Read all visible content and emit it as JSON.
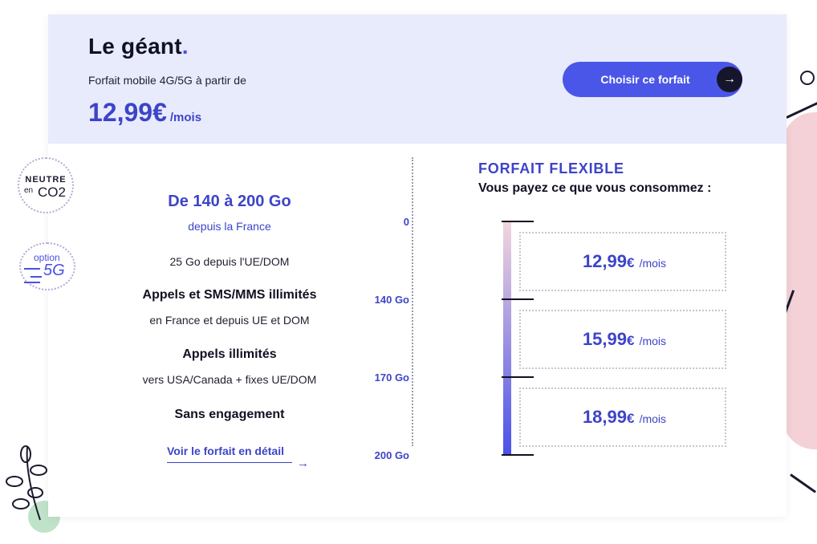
{
  "header": {
    "title": "Le géant",
    "title_dot": ".",
    "subtitle": "Forfait mobile 4G/5G à partir de",
    "price": "12,99€",
    "price_unit": "/mois",
    "cta_label": "Choisir ce forfait"
  },
  "badges": {
    "neutral_line1": "NEUTRE",
    "neutral_en": "en",
    "neutral_co2": "CO2",
    "option_label": "option",
    "option_5g": "5G"
  },
  "features": {
    "data": "De 140 à 200 Go",
    "data_sub": "depuis la France",
    "eu_data": "25 Go depuis l'UE/DOM",
    "calls_sms": "Appels et SMS/MMS illimités",
    "calls_sms_sub": "en France et depuis UE et DOM",
    "calls_intl": "Appels illimités",
    "calls_intl_sub": "vers USA/Canada + fixes UE/DOM",
    "commitment": "Sans engagement",
    "detail_link": "Voir le forfait en détail"
  },
  "flexible": {
    "title": "FORFAIT FLEXIBLE",
    "subtitle": "Vous payez ce que vous consommez :",
    "scale": [
      "0",
      "140 Go",
      "170 Go",
      "200 Go"
    ],
    "tiers": [
      {
        "whole": "12,99",
        "currency": "€",
        "unit": "/mois"
      },
      {
        "whole": "15,99",
        "currency": "€",
        "unit": "/mois"
      },
      {
        "whole": "18,99",
        "currency": "€",
        "unit": "/mois"
      }
    ]
  },
  "colors": {
    "accent": "#3d44c8",
    "button": "#4a56e8",
    "header_bg": "#e8ebfc",
    "dark": "#15162b"
  }
}
